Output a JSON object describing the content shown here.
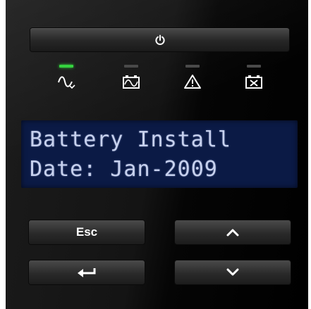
{
  "power": {
    "icon": "power-icon"
  },
  "indicators": [
    {
      "icon": "sine-wave-icon",
      "led_color": "#35d43f",
      "lit": true
    },
    {
      "icon": "battery-icon",
      "led_color": "#4a4a4a",
      "lit": false
    },
    {
      "icon": "warning-triangle-icon",
      "led_color": "#4a4a4a",
      "lit": false
    },
    {
      "icon": "battery-fault-icon",
      "led_color": "#4a4a4a",
      "lit": false
    }
  ],
  "lcd": {
    "line1": "Battery Install",
    "line2": "Date: Jan-2009",
    "background": "#0b1a45",
    "text_color": "#c7d1ee"
  },
  "buttons": {
    "esc_label": "Esc",
    "enter_icon": "enter-arrow-icon",
    "up_icon": "chevron-up-icon",
    "down_icon": "chevron-down-icon"
  }
}
